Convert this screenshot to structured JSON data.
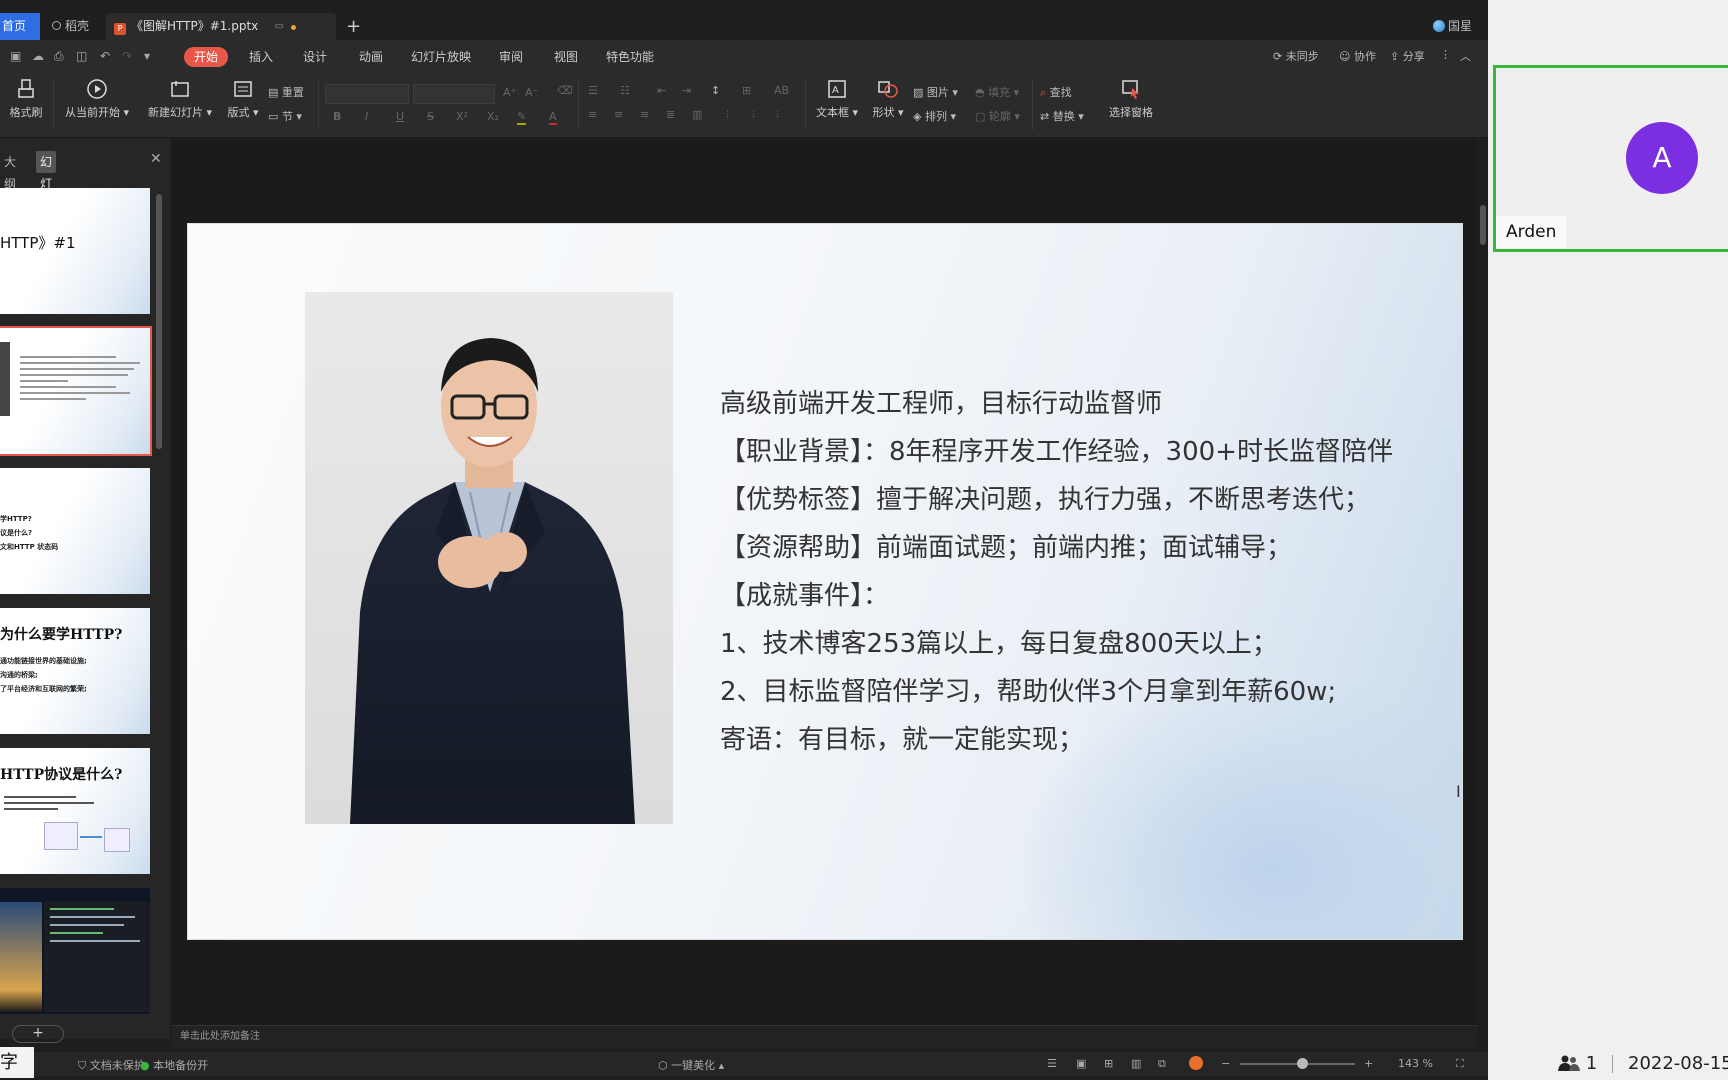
{
  "tabs": {
    "home": "首页",
    "daoke": "稻壳",
    "file": "《图解HTTP》#1.pptx",
    "add": "+",
    "user": "国星"
  },
  "menu": {
    "items": [
      "开始",
      "插入",
      "设计",
      "动画",
      "幻灯片放映",
      "审阅",
      "视图",
      "特色功能"
    ],
    "sync": "未同步",
    "collab": "协作",
    "share": "分享"
  },
  "toolbar": {
    "format_painter": "格式刷",
    "from_current": "从当前开始",
    "new_slide": "新建幻灯片",
    "layout": "版式",
    "reset": "重置",
    "section": "节",
    "textbox": "文本框",
    "shape": "形状",
    "picture": "图片",
    "fill": "填充",
    "arrange": "排列",
    "outline": "轮廓",
    "find": "查找",
    "replace": "替换",
    "select_pane": "选择窗格"
  },
  "panel": {
    "tab_outline": "大纲",
    "tab_slides": "幻灯片",
    "thumb1_title": "HTTP》#1",
    "thumb3_lines": [
      "学HTTP?",
      "议是什么?",
      "文和HTTP 状态码"
    ],
    "thumb4_title": "为什么要学HTTP?",
    "thumb4_lines": [
      "通功能链接世界的基础设施;",
      "沟通的桥梁;",
      "了平台经济和互联网的繁荣;"
    ],
    "thumb5_title": "HTTP协议是什么?"
  },
  "slide": {
    "lines": [
      "高级前端开发工程师，目标行动监督师",
      "【职业背景】：8年程序开发工作经验，300+时长监督陪伴",
      "【优势标签】擅于解决问题，执行力强，不断思考迭代；",
      "【资源帮助】前端面试题；前端内推；面试辅导；",
      "【成就事件】：",
      "1、技术博客253篇以上，每日复盘800天以上；",
      "2、目标监督陪伴学习，帮助伙伴3个月拿到年薪60w;",
      "寄语：有目标，就一定能实现；"
    ]
  },
  "notes": "单击此处添加备注",
  "status": {
    "doc_protect": "文档未保护",
    "local_backup": "本地备份开",
    "beautify": "一键美化",
    "zoom": "143 %"
  },
  "overlay": {
    "subtitle": "字幕"
  },
  "meeting": {
    "avatar_letter": "A",
    "name": "Arden",
    "participants": "1",
    "date": "2022-08-15"
  },
  "colors": {
    "accent_red": "#e8584a",
    "avatar_purple": "#7a2fe0",
    "speaker_green": "#3cb53c"
  }
}
